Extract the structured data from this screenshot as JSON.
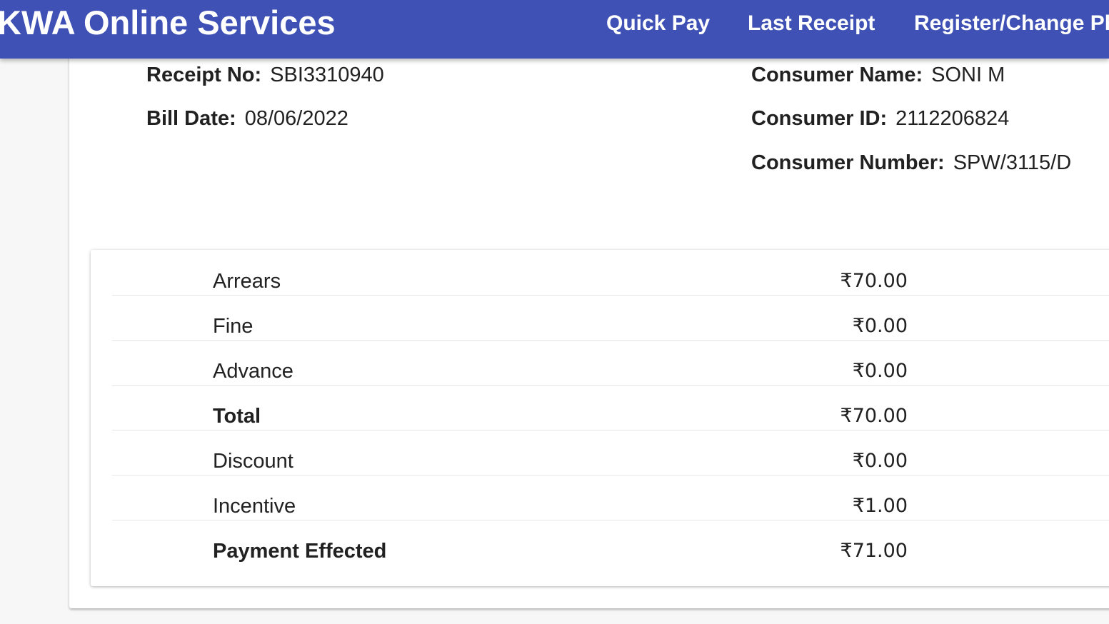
{
  "header": {
    "title": "KWA Online Services",
    "nav": [
      "Quick Pay",
      "Last Receipt",
      "Register/Change Ph"
    ]
  },
  "receipt": {
    "receipt_no_label": "Receipt No:",
    "receipt_no": "SBI3310940",
    "bill_date_label": "Bill Date:",
    "bill_date": "08/06/2022",
    "consumer_name_label": "Consumer Name:",
    "consumer_name": "SONI M",
    "consumer_id_label": "Consumer ID:",
    "consumer_id": "2112206824",
    "consumer_number_label": "Consumer Number:",
    "consumer_number": "SPW/3115/D"
  },
  "summary": [
    {
      "label": "Arrears",
      "amount": "₹70.00",
      "bold": false
    },
    {
      "label": "Fine",
      "amount": "₹0.00",
      "bold": false
    },
    {
      "label": "Advance",
      "amount": "₹0.00",
      "bold": false
    },
    {
      "label": "Total",
      "amount": "₹70.00",
      "bold": true
    },
    {
      "label": "Discount",
      "amount": "₹0.00",
      "bold": false
    },
    {
      "label": "Incentive",
      "amount": "₹1.00",
      "bold": false
    },
    {
      "label": "Payment Effected",
      "amount": "₹71.00",
      "bold": true
    }
  ]
}
